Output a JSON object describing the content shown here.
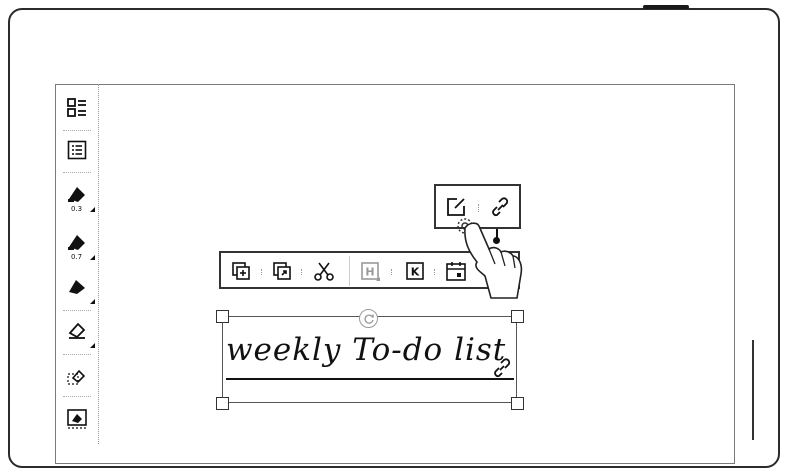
{
  "side_toolbar": {
    "tools": [
      {
        "name": "layout-icon"
      },
      {
        "name": "list-icon"
      },
      {
        "name": "pen-icon",
        "size": "0.3"
      },
      {
        "name": "pen-icon",
        "size": "0.7"
      },
      {
        "name": "marker-icon"
      },
      {
        "name": "eraser-icon"
      },
      {
        "name": "lasso-eraser-icon"
      },
      {
        "name": "area-eraser-icon"
      }
    ]
  },
  "lasso_toolbar": {
    "buttons": [
      {
        "name": "copy-icon"
      },
      {
        "name": "paste-icon"
      },
      {
        "name": "cut-icon"
      },
      {
        "name": "heading-icon",
        "label": "H"
      },
      {
        "name": "keyword-icon",
        "label": "K"
      },
      {
        "name": "calendar-icon"
      }
    ]
  },
  "popover": {
    "buttons": [
      {
        "name": "edit-link-icon"
      },
      {
        "name": "link-icon"
      }
    ]
  },
  "selection": {
    "handwriting_text": "weekly To-do list"
  },
  "colors": {
    "ink": "#111111",
    "frame": "#2b2b2b",
    "page_border": "#7a7a7a"
  }
}
